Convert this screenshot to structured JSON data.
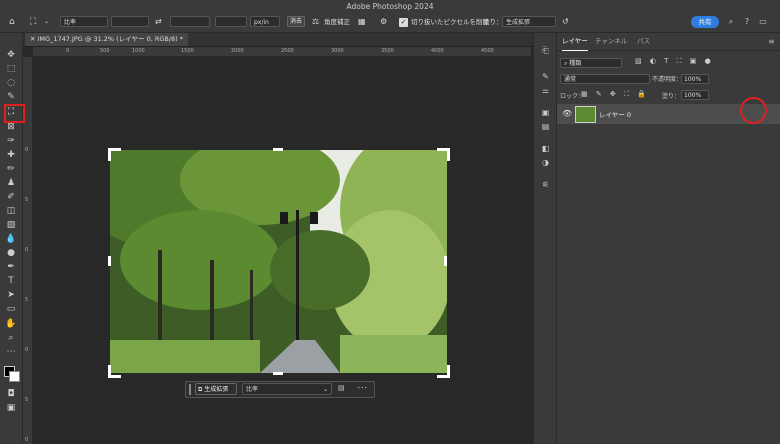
{
  "app": {
    "title": "Adobe Photoshop 2024"
  },
  "options": {
    "ratio_label": "比率",
    "unit_select": "px/in",
    "clear_button": "消去",
    "straighten_label": "角度補正",
    "delete_cropped_label": "切り抜いたピクセルを削除",
    "fill_label": "塗り：",
    "fill_value": "生成拡張",
    "share_button": "共有"
  },
  "document": {
    "tab_title": "IMG_1747.JPG @ 31.2% (レイヤー 0, RGB/8) *",
    "ruler_ticks": [
      "0",
      "500",
      "1000",
      "1500",
      "2000",
      "2500",
      "3000",
      "3500",
      "4000",
      "4500"
    ],
    "vruler_ticks": [
      "0",
      "5",
      "0",
      "5",
      "0",
      "5",
      "0"
    ]
  },
  "context_bar": {
    "generate_button": "生成拡張",
    "ratio_select": "比率",
    "more": "･･･"
  },
  "layers_panel": {
    "tabs": [
      "レイヤー",
      "チャンネル",
      "パス"
    ],
    "filter_kind": "種類",
    "blend_mode": "通常",
    "opacity_label": "不透明度：",
    "opacity_value": "100%",
    "lock_label": "ロック：",
    "fill_label": "塗り：",
    "fill_value": "100%",
    "layers": [
      {
        "name": "レイヤー 0"
      }
    ]
  },
  "colors": {
    "accent": "#2f7de1",
    "highlight": "#e02020"
  }
}
